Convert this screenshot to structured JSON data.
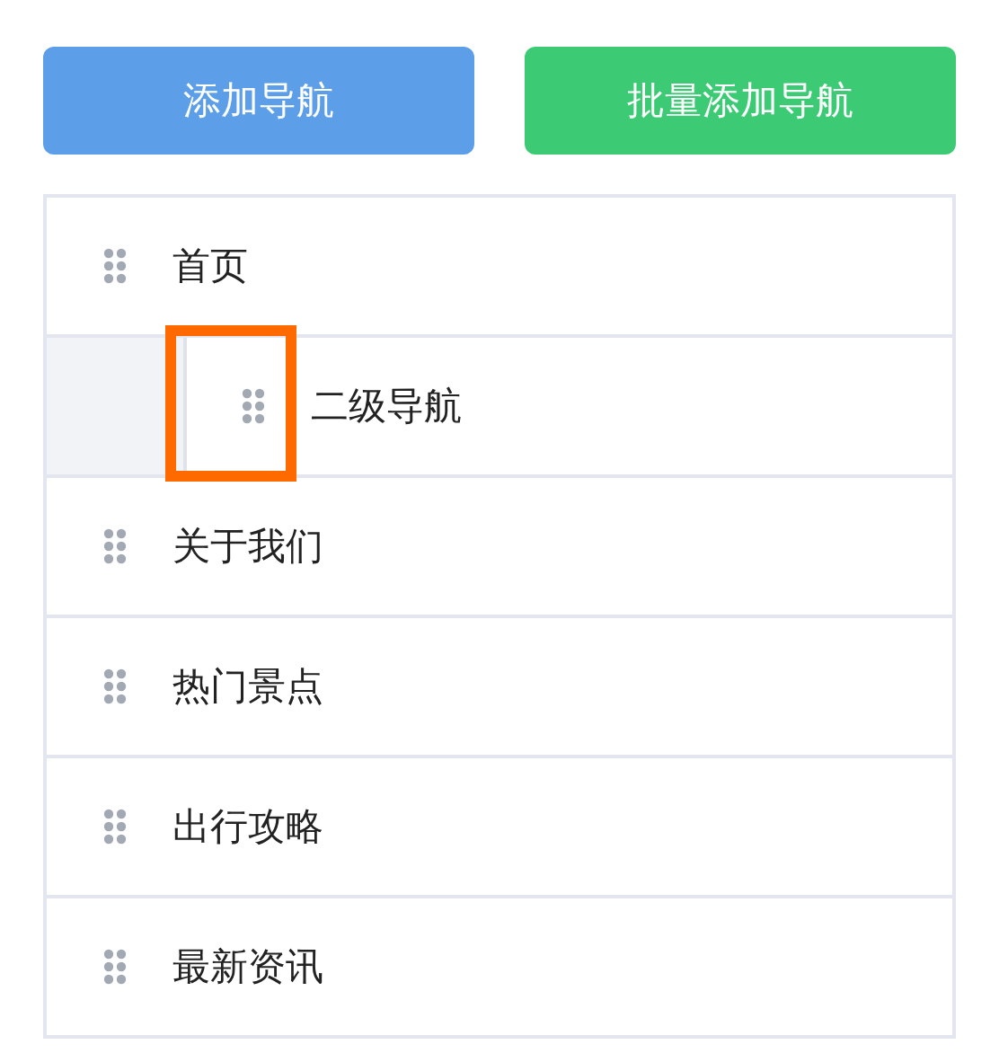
{
  "buttons": [
    {
      "label": "添加导航",
      "kind": "primary"
    },
    {
      "label": "批量添加导航",
      "kind": "success"
    }
  ],
  "nav_items": [
    {
      "label": "首页",
      "children": [
        {
          "label": "二级导航"
        }
      ]
    },
    {
      "label": "关于我们"
    },
    {
      "label": "热门景点"
    },
    {
      "label": "出行攻略"
    },
    {
      "label": "最新资讯"
    }
  ]
}
